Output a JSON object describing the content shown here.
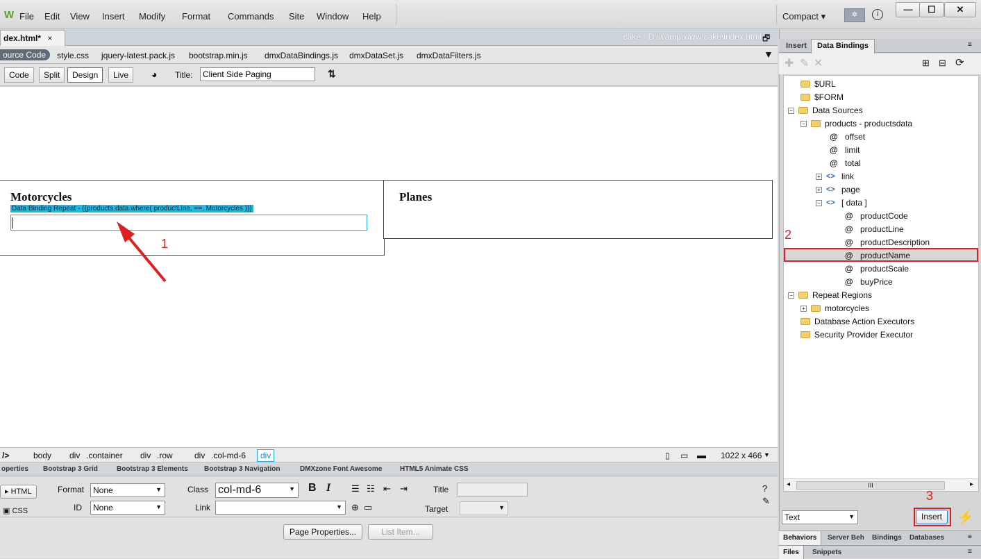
{
  "app": {
    "logo": "W",
    "menu": [
      "File",
      "Edit",
      "View",
      "Insert",
      "Modify",
      "Format",
      "Commands",
      "Site",
      "Window",
      "Help"
    ],
    "workspace": "Compact",
    "workspace_arrow": "▾"
  },
  "document": {
    "tab": "dex.html*",
    "tab_close": "×",
    "path": "cake - D:\\wamp\\www\\cake\\index.html",
    "related_files": [
      "ource Code",
      "style.css",
      "jquery-latest.pack.js",
      "bootstrap.min.js",
      "dmxDataBindings.js",
      "dmxDataSet.js",
      "dmxDataFilters.js"
    ]
  },
  "toolbar": {
    "views": [
      "Code",
      "Split",
      "Design",
      "Live"
    ],
    "title_label": "Title:",
    "title_value": "Client Side Paging"
  },
  "design": {
    "motorcycles": "Motorcycles",
    "planes": "Planes",
    "repeat": "Data Binding Repeat - {{products.data.where( productLine, ==, Motorcycles )}}"
  },
  "tagbar": {
    "items": [
      "/>",
      "body",
      "div",
      ".container",
      "div",
      ".row",
      "div",
      ".col-md-6",
      "div"
    ],
    "size": "1022 x 466"
  },
  "panel_tabs": [
    "operties",
    "Bootstrap 3 Grid",
    "Bootstrap 3 Elements",
    "Bootstrap 3 Navigation",
    "DMXzone Font Awesome",
    "HTML5 Animate CSS"
  ],
  "properties": {
    "html": "HTML",
    "css": "CSS",
    "format_label": "Format",
    "format_value": "None",
    "class_label": "Class",
    "class_value": "col-md-6",
    "id_label": "ID",
    "id_value": "None",
    "link_label": "Link",
    "title_label": "Title",
    "target_label": "Target",
    "bold": "B",
    "italic": "I",
    "page_props": "Page Properties...",
    "list_item": "List Item..."
  },
  "right_panel": {
    "tabs": [
      "Insert",
      "Data Bindings"
    ],
    "tree": [
      "$URL",
      "$FORM",
      "Data Sources",
      "products - productsdata",
      "offset",
      "limit",
      "total",
      "link",
      "page",
      "[ data ]",
      "productCode",
      "productLine",
      "productDescription",
      "productName",
      "productScale",
      "buyPrice",
      "Repeat Regions",
      "motorcycles",
      "Database Action Executors",
      "Security Provider Executor"
    ],
    "insert_as": "Text",
    "insert_button": "Insert",
    "scroll_mark": "III",
    "bottom_tabs1": [
      "Behaviors",
      "Server Beh",
      "Bindings",
      "Databases"
    ],
    "bottom_tabs2": [
      "Files",
      "Snippets"
    ]
  },
  "annotations": [
    "1",
    "2",
    "3"
  ],
  "colors": {
    "highlight": "#17bdea",
    "annotation": "#e02020"
  }
}
